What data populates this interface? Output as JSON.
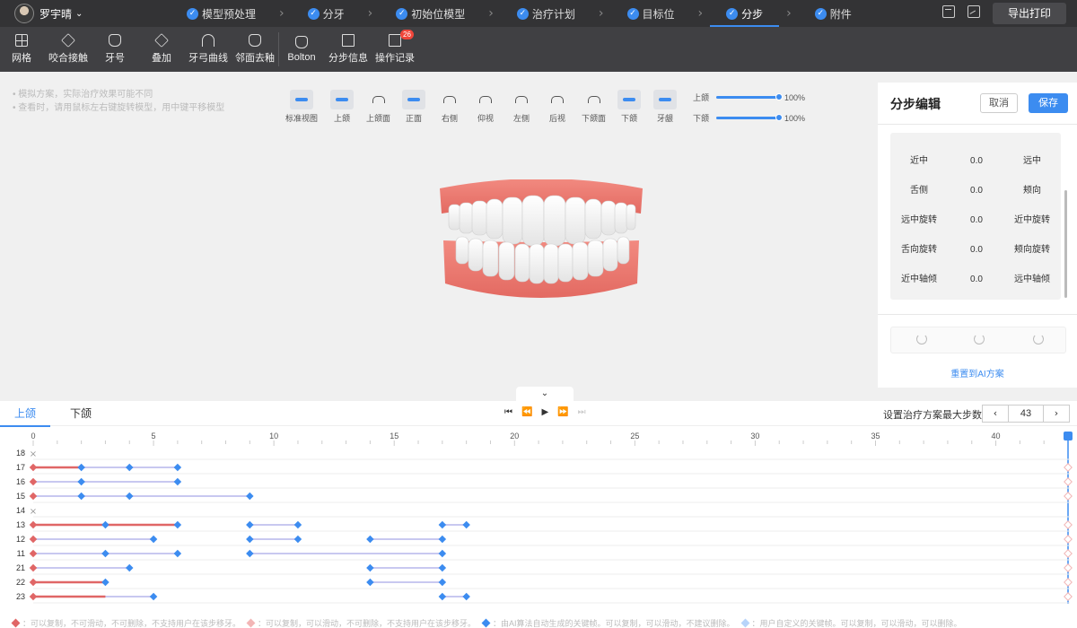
{
  "user": {
    "name": "罗宇晴"
  },
  "steps": [
    {
      "label": "模型预处理",
      "active": false
    },
    {
      "label": "分牙",
      "active": false
    },
    {
      "label": "初始位模型",
      "active": false
    },
    {
      "label": "治疗计划",
      "active": false
    },
    {
      "label": "目标位",
      "active": false
    },
    {
      "label": "分步",
      "active": true
    },
    {
      "label": "附件",
      "active": false
    }
  ],
  "topbar": {
    "export_label": "导出打印"
  },
  "tools": [
    {
      "label": "网格",
      "icon": "grid-icon"
    },
    {
      "label": "咬合接触",
      "icon": "occlusion-icon"
    },
    {
      "label": "牙号",
      "icon": "tooth-number-icon"
    },
    {
      "label": "叠加",
      "icon": "overlay-icon"
    },
    {
      "label": "牙弓曲线",
      "icon": "arch-curve-icon"
    },
    {
      "label": "邻面去釉",
      "icon": "ipr-icon"
    },
    {
      "label": "Bolton",
      "icon": "bolton-icon"
    },
    {
      "label": "分步信息",
      "icon": "step-info-icon"
    },
    {
      "label": "操作记录",
      "icon": "log-icon"
    }
  ],
  "log_badge": "26",
  "hints": [
    "模拟方案，实际治疗效果可能不同",
    "查看时，请用鼠标左右键旋转模型，用中键平移模型"
  ],
  "views": [
    "标准视图",
    "上颌",
    "上颌面",
    "正面",
    "右侧",
    "仰视",
    "左侧",
    "后视",
    "下颌面",
    "下颌",
    "牙龈"
  ],
  "opacity": [
    {
      "label": "上颌",
      "value": "100%",
      "fraction": 1.0
    },
    {
      "label": "下颌",
      "value": "100%",
      "fraction": 1.0
    }
  ],
  "panel": {
    "title": "分步编辑",
    "cancel_label": "取消",
    "save_label": "保存",
    "rows": [
      {
        "left": "近中",
        "value": "0.0",
        "right": "远中"
      },
      {
        "left": "舌侧",
        "value": "0.0",
        "right": "颊向"
      },
      {
        "left": "远中旋转",
        "value": "0.0",
        "right": "近中旋转"
      },
      {
        "left": "舌向旋转",
        "value": "0.0",
        "right": "颊向旋转"
      },
      {
        "left": "近中轴倾",
        "value": "0.0",
        "right": "远中轴倾"
      }
    ],
    "reset_label": "重置到AI方案"
  },
  "timeline": {
    "tabs": [
      "上颌",
      "下颌"
    ],
    "active_tab": 0,
    "max_steps_label": "设置治疗方案最大步数",
    "max_steps": "43",
    "legend": [
      {
        "text": "：可以复制，不可滑动，不可删除，不支持用户在该步移牙。",
        "color": "#e06666"
      },
      {
        "text": "：可以复制，可以滑动，不可删除，不支持用户在该步移牙。",
        "color": "#f2b6b6"
      },
      {
        "text": "：由AI算法自动生成的关键帧。可以复制，可以滑动，不建议删除。",
        "color": "#3c8cf0"
      },
      {
        "text": "：用户自定义的关键帧。可以复制，可以滑动，可以删除。",
        "color": "#b8d4fa"
      }
    ]
  },
  "colors": {
    "accent": "#3c8cf0",
    "red": "#e06666",
    "purple": "#c8c8f0"
  },
  "chart_data": {
    "type": "timeline",
    "x_ticks": [
      0,
      5,
      10,
      15,
      20,
      25,
      30,
      35,
      40
    ],
    "max_step": 43,
    "current_step": 43,
    "rows": [
      {
        "tooth": "18",
        "absent": true,
        "red_to": 0,
        "keys": []
      },
      {
        "tooth": "17",
        "red_to": 2,
        "keys": [
          2,
          4,
          6
        ]
      },
      {
        "tooth": "16",
        "red_to": 0,
        "keys": [
          2,
          6
        ]
      },
      {
        "tooth": "15",
        "red_to": 0,
        "keys": [
          2,
          4,
          9
        ]
      },
      {
        "tooth": "14",
        "absent": true,
        "red_to": 0,
        "keys": []
      },
      {
        "tooth": "13",
        "red_to": 6,
        "keys": [
          3,
          6
        ],
        "extra": [
          [
            9,
            11
          ],
          [
            17,
            18
          ]
        ]
      },
      {
        "tooth": "12",
        "red_to": 0,
        "keys": [
          5
        ],
        "extra": [
          [
            9,
            11
          ],
          [
            14,
            17
          ]
        ]
      },
      {
        "tooth": "11",
        "red_to": 0,
        "keys": [
          3,
          6
        ],
        "extra": [
          [
            9,
            17
          ]
        ]
      },
      {
        "tooth": "21",
        "red_to": 0,
        "keys": [
          4
        ],
        "extra": [
          [
            14,
            17
          ]
        ]
      },
      {
        "tooth": "22",
        "red_to": 3,
        "keys": [
          3
        ],
        "extra": [
          [
            14,
            17
          ]
        ]
      },
      {
        "tooth": "23",
        "red_to": 3,
        "keys": [
          5
        ],
        "extra": [
          [
            17,
            18
          ]
        ]
      }
    ]
  }
}
